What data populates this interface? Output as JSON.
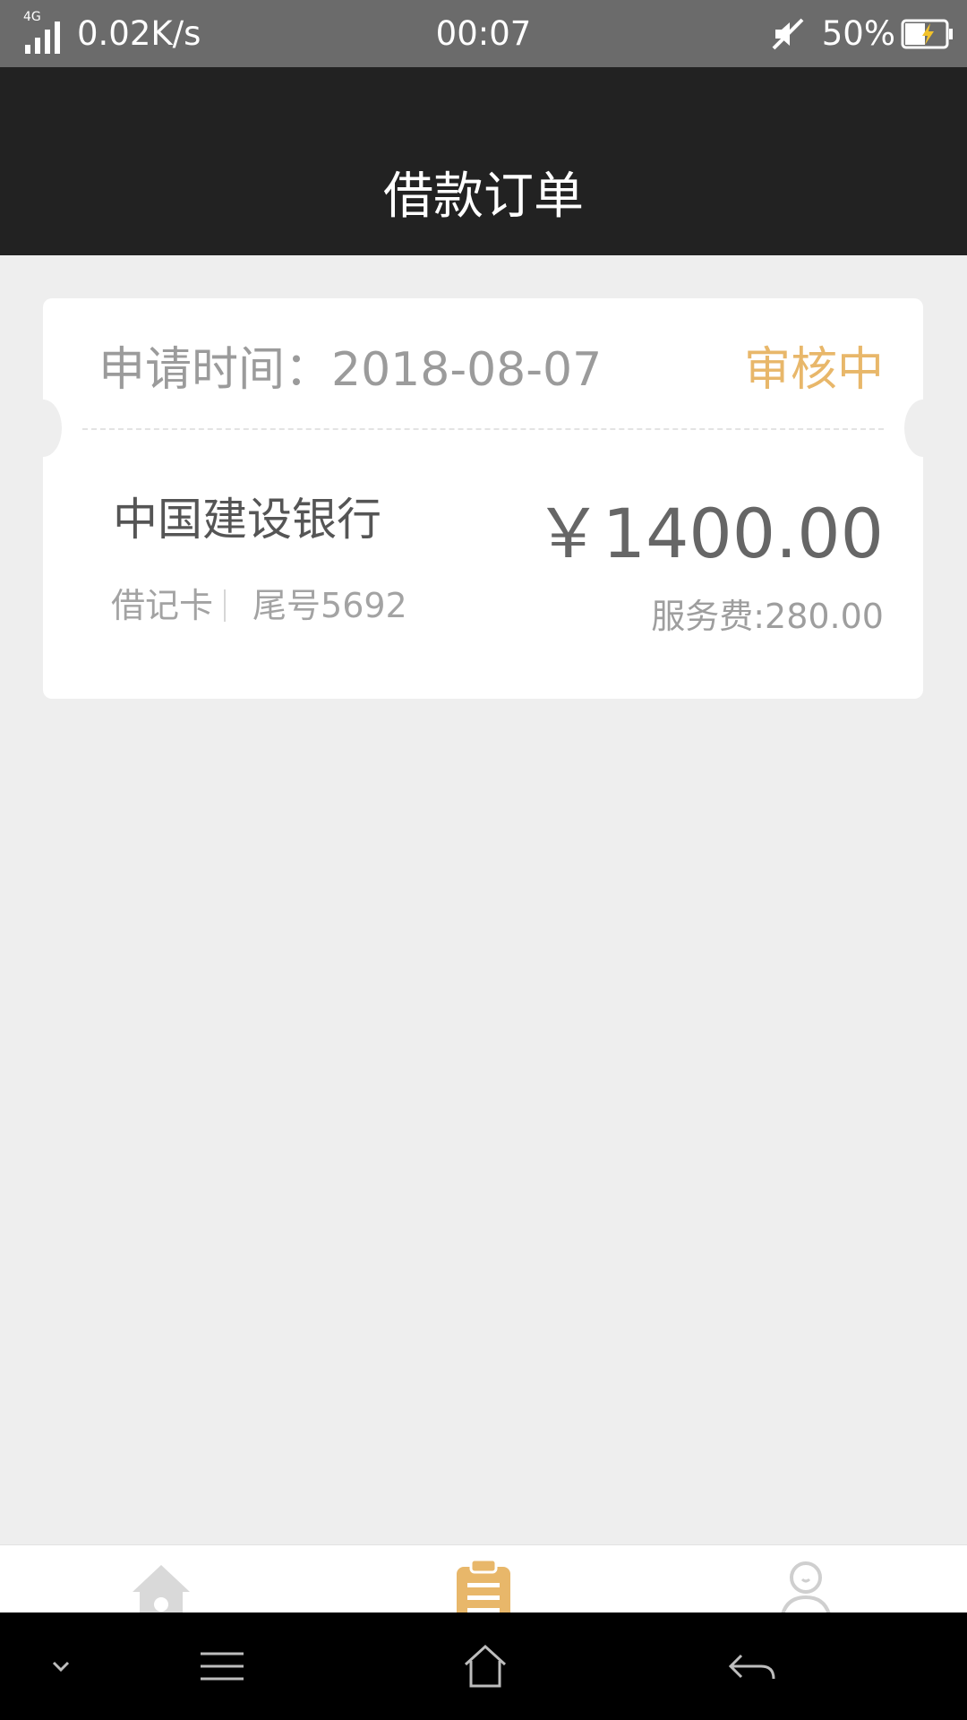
{
  "status_bar": {
    "network_type": "4G",
    "net_speed": "0.02K/s",
    "time": "00:07",
    "battery": "50%"
  },
  "header": {
    "title": "借款订单"
  },
  "order": {
    "apply_time": "申请时间：2018-08-07",
    "status": "审核中",
    "bank_name": "中国建设银行",
    "card_type": "借记卡",
    "tail_number": "尾号5692",
    "amount": "￥1400.00",
    "service_fee": "服务费:280.00"
  },
  "colors": {
    "accent": "#e8b76a",
    "header_bg": "#222222",
    "page_bg": "#eeeeee"
  },
  "tabs": [
    {
      "icon": "home-icon",
      "active": false
    },
    {
      "icon": "clipboard-icon",
      "active": true
    },
    {
      "icon": "user-icon",
      "active": false
    }
  ],
  "nav_bar": {
    "icons": [
      "chevron-down-icon",
      "menu-icon",
      "home-icon",
      "back-icon"
    ]
  }
}
